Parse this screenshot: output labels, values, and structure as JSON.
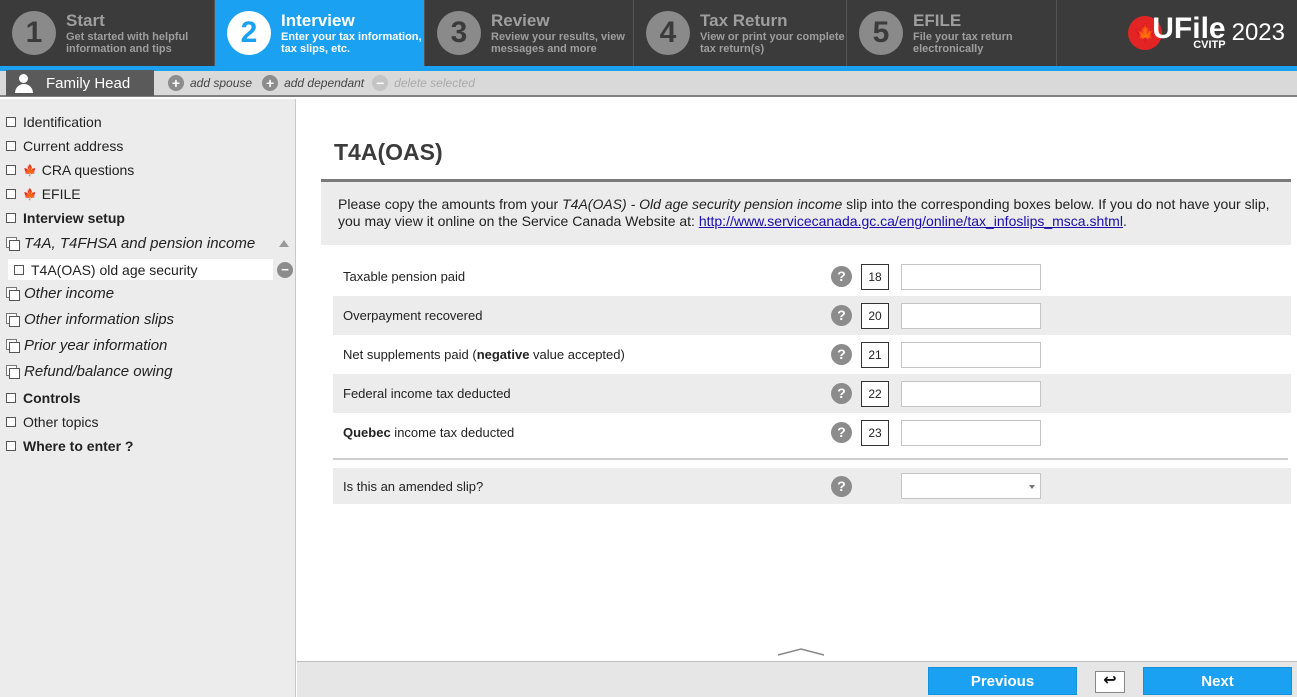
{
  "steps": [
    {
      "num": "1",
      "title": "Start",
      "desc1": "Get started with helpful",
      "desc2": "information and tips",
      "active": false
    },
    {
      "num": "2",
      "title": "Interview",
      "desc1": "Enter your tax information,",
      "desc2": "tax slips, etc.",
      "active": true
    },
    {
      "num": "3",
      "title": "Review",
      "desc1": "Review your results, view",
      "desc2": "messages and more",
      "active": false
    },
    {
      "num": "4",
      "title": "Tax Return",
      "desc1": "View or print your complete",
      "desc2": "tax return(s)",
      "active": false
    },
    {
      "num": "5",
      "title": "EFILE",
      "desc1": "File your tax return",
      "desc2": "electronically",
      "active": false
    }
  ],
  "brand": {
    "word": "UFile",
    "sub": "CVITP",
    "year": "2023",
    "leaf": "🍁"
  },
  "family": {
    "tab_label": "Family Head",
    "add_spouse": "add spouse",
    "add_dependant": "add dependant",
    "delete_selected": "delete selected"
  },
  "sidebar": {
    "items": [
      {
        "label": "Identification"
      },
      {
        "label": "Current address"
      },
      {
        "label": "CRA questions"
      },
      {
        "label": "EFILE"
      },
      {
        "label": "Interview setup"
      },
      {
        "label": "T4A, T4FHSA and pension income"
      },
      {
        "label": "T4A(OAS) old age security"
      },
      {
        "label": "Other income"
      },
      {
        "label": "Other information slips"
      },
      {
        "label": "Prior year information"
      },
      {
        "label": "Refund/balance owing"
      },
      {
        "label": "Controls"
      },
      {
        "label": "Other topics"
      },
      {
        "label": "Where to enter ?"
      }
    ],
    "leaf_glyph": "🍁"
  },
  "main": {
    "title": "T4A(OAS)",
    "instructions": {
      "part1": "Please copy the amounts from your ",
      "slip_name": "T4A(OAS) - Old age security pension income",
      "part2": " slip into the corresponding boxes below. If you do not have your slip, you may view it online on the Service Canada Website at: ",
      "link": "http://www.servicecanada.gc.ca/eng/online/tax_infoslips_msca.shtml",
      "part3": "."
    },
    "fields": [
      {
        "label": "Taxable pension paid",
        "box": "18",
        "value": ""
      },
      {
        "label": "Overpayment recovered",
        "box": "20",
        "value": ""
      },
      {
        "label_pre": "Net supplements paid (",
        "label_bold": "negative",
        "label_post": " value accepted)",
        "box": "21",
        "value": ""
      },
      {
        "label": "Federal income tax deducted",
        "box": "22",
        "value": ""
      },
      {
        "label_bold": "Quebec",
        "label_post": " income tax deducted",
        "box": "23",
        "value": ""
      }
    ],
    "amended": {
      "label": "Is this an amended slip?",
      "selected": ""
    },
    "help_glyph": "?"
  },
  "footer": {
    "previous": "Previous",
    "next": "Next",
    "back_glyph": "↩"
  },
  "colors": {
    "accent": "#1ba1f2",
    "topbar": "#3b3b3b",
    "sidebar": "#ececec"
  }
}
